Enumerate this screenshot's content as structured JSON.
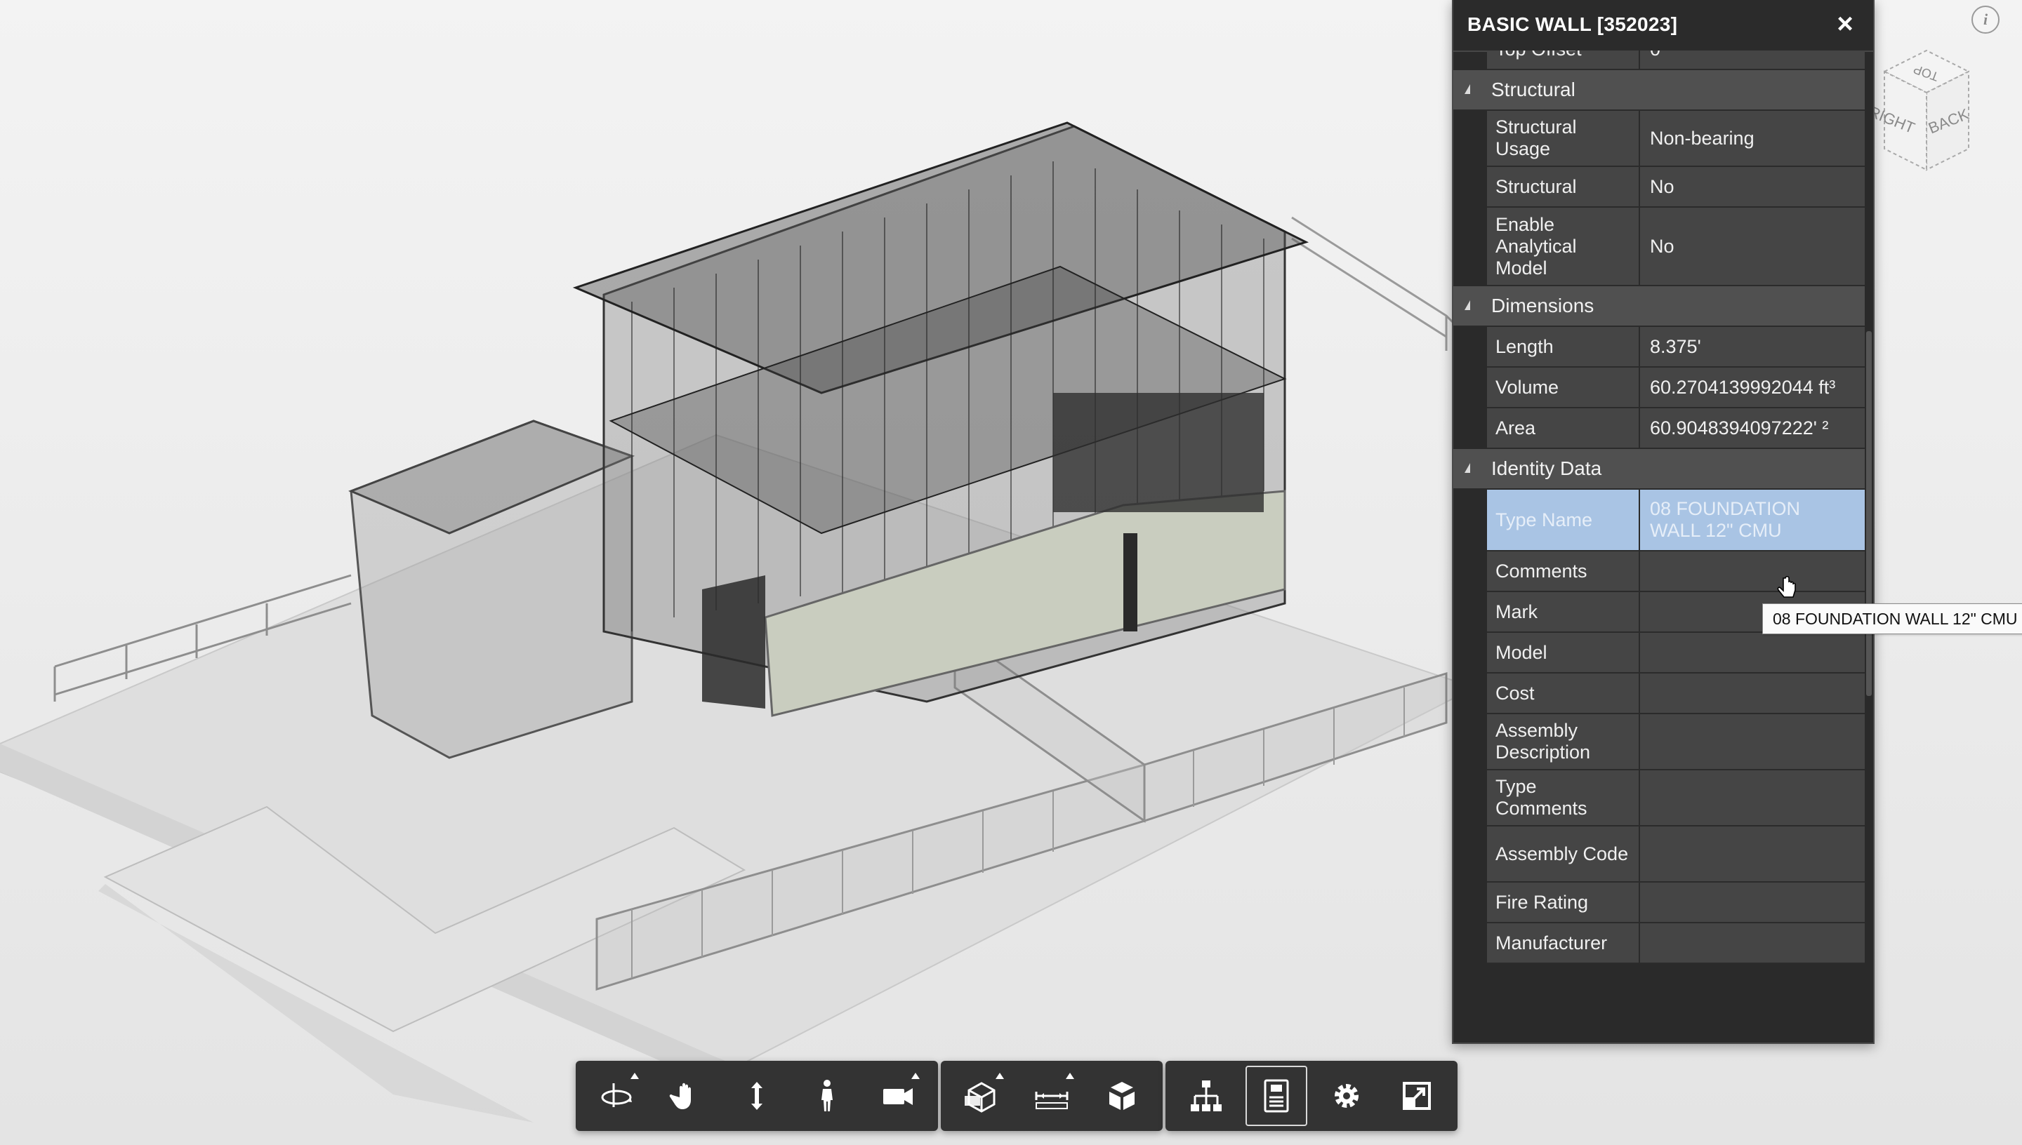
{
  "panel": {
    "title": "BASIC WALL [352023]",
    "close_label": "×",
    "rows": [
      {
        "type": "prop",
        "key": "Top Offset",
        "value": "0'"
      },
      {
        "type": "cat",
        "label": "Structural"
      },
      {
        "type": "prop",
        "key": "Structural Usage",
        "value": "Non-bearing"
      },
      {
        "type": "prop",
        "key": "Structural",
        "value": "No"
      },
      {
        "type": "prop",
        "key": "Enable Analytical Model",
        "value": "No"
      },
      {
        "type": "cat",
        "label": "Dimensions"
      },
      {
        "type": "prop",
        "key": "Length",
        "value": "8.375'"
      },
      {
        "type": "prop",
        "key": "Volume",
        "value": "60.2704139992044 ft³"
      },
      {
        "type": "prop",
        "key": "Area",
        "value": "60.9048394097222' ²"
      },
      {
        "type": "cat",
        "label": "Identity Data"
      },
      {
        "type": "prop",
        "key": "Type Name",
        "value": "08 FOUNDATION WALL 12\" CMU",
        "selected": true
      },
      {
        "type": "prop",
        "key": "Comments",
        "value": ""
      },
      {
        "type": "prop",
        "key": "Mark",
        "value": ""
      },
      {
        "type": "prop",
        "key": "Model",
        "value": ""
      },
      {
        "type": "prop",
        "key": "Cost",
        "value": ""
      },
      {
        "type": "prop",
        "key": "Assembly Description",
        "value": ""
      },
      {
        "type": "prop",
        "key": "Type Comments",
        "value": ""
      },
      {
        "type": "prop",
        "key": "Assembly Code",
        "value": ""
      },
      {
        "type": "prop",
        "key": "Fire Rating",
        "value": ""
      },
      {
        "type": "prop",
        "key": "Manufacturer",
        "value": ""
      }
    ]
  },
  "tooltip": "08 FOUNDATION WALL 12\" CMU",
  "viewcube": {
    "top": "TOP",
    "back": "BACK",
    "right": "RIGHT"
  },
  "info_label": "i",
  "toolbar": {
    "groups": [
      {
        "buttons": [
          {
            "name": "orbit-icon",
            "caret": true
          },
          {
            "name": "pan-icon",
            "caret": false
          },
          {
            "name": "zoom-icon",
            "caret": false
          },
          {
            "name": "first-person-icon",
            "caret": false
          },
          {
            "name": "camera-icon",
            "caret": true
          }
        ]
      },
      {
        "buttons": [
          {
            "name": "section-icon",
            "caret": true
          },
          {
            "name": "measure-icon",
            "caret": true
          },
          {
            "name": "explode-icon",
            "caret": false
          }
        ]
      },
      {
        "buttons": [
          {
            "name": "model-browser-icon",
            "caret": false
          },
          {
            "name": "properties-icon",
            "caret": false,
            "active": true
          },
          {
            "name": "settings-icon",
            "caret": false
          },
          {
            "name": "fullscreen-icon",
            "caret": false
          }
        ]
      }
    ]
  }
}
